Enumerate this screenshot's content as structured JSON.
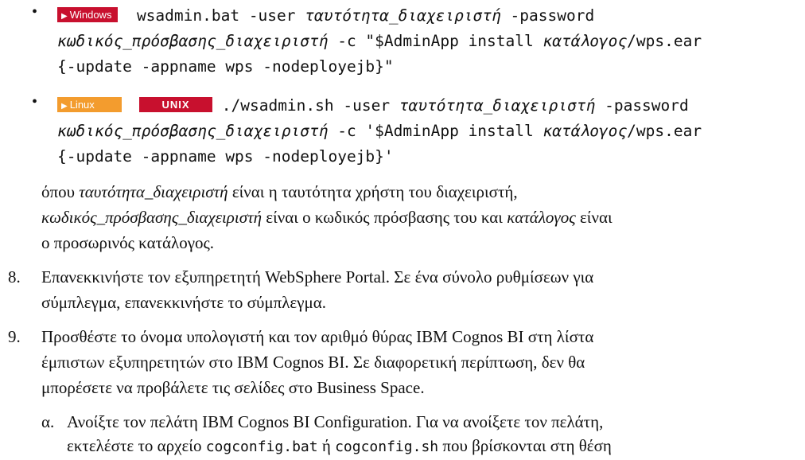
{
  "bullets": [
    {
      "badges": [
        "Windows"
      ],
      "l1_cmd": "wsadmin.bat -user ",
      "l1_it": "ταυτότητα_διαχειριστή",
      "l1_tail": " -password",
      "l2_it1": "κωδικός_πρόσβασης_διαχειριστή",
      "l2_mid": " -c \"$AdminApp install ",
      "l2_it2": "κατάλογος",
      "l2_tail": "/wps.ear",
      "l3": "{-update -appname wps -nodeployejb}\""
    },
    {
      "badges": [
        "Linux",
        "UNIX"
      ],
      "l1_cmd": "./wsadmin.sh -user ",
      "l1_it": "ταυτότητα_διαχειριστή",
      "l1_tail": " -password",
      "l2_it1": "κωδικός_πρόσβασης_διαχειριστή",
      "l2_mid": " -c '$AdminApp install ",
      "l2_it2": "κατάλογος",
      "l2_tail": "/wps.ear",
      "l3": "{-update -appname wps -nodeployejb}'"
    }
  ],
  "note": {
    "l1_a": "όπου ",
    "l1_it": "ταυτότητα_διαχειριστή",
    "l1_b": " είναι η ταυτότητα χρήστη του διαχειριστή,",
    "l2_it1": "κωδικός_πρόσβασης_διαχειριστή",
    "l2_b": " είναι ο κωδικός πρόσβασης του και ",
    "l2_it2": "κατάλογος",
    "l2_c": " είναι",
    "l3": "ο προσωρινός κατάλογος."
  },
  "step8": {
    "num": "8.",
    "l1": "Επανεκκινήστε τον εξυπηρετητή WebSphere Portal. Σε ένα σύνολο ρυθμίσεων για",
    "l2": "σύμπλεγμα, επανεκκινήστε το σύμπλεγμα."
  },
  "step9": {
    "num": "9.",
    "l1": "Προσθέστε το όνομα υπολογιστή και τον αριθμό θύρας IBM Cognos BI στη λίστα",
    "l2": "έμπιστων εξυπηρετητών στο IBM Cognos BI. Σε διαφορετική περίπτωση, δεν θα",
    "l3": "μπορέσετε να προβάλετε τις σελίδες στο Business Space."
  },
  "substep_a": {
    "num": "α.",
    "l1": "Ανοίξτε τον πελάτη IBM Cognos BI Configuration. Για να ανοίξετε τον πελάτη,",
    "l2_a": "εκτελέστε το αρχείο ",
    "l2_code1": "cogconfig.bat",
    "l2_b": " ή ",
    "l2_code2": "cogconfig.sh",
    "l2_c": " που βρίσκονται στη θέση"
  }
}
